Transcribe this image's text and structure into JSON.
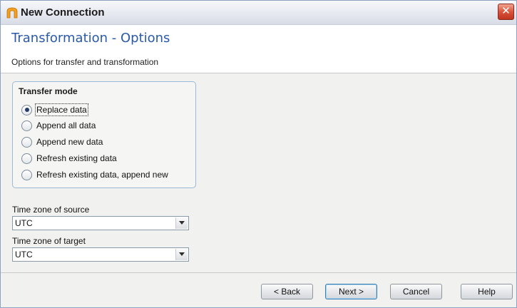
{
  "window": {
    "title": "New Connection",
    "close_glyph": "✕"
  },
  "header": {
    "title": "Transformation - Options",
    "subtitle": "Options for transfer and transformation"
  },
  "transfer_mode": {
    "label": "Transfer mode",
    "options": [
      {
        "label": "Replace data",
        "checked": true
      },
      {
        "label": "Append all data",
        "checked": false
      },
      {
        "label": "Append new data",
        "checked": false
      },
      {
        "label": "Refresh existing data",
        "checked": false
      },
      {
        "label": "Refresh existing data, append new",
        "checked": false
      }
    ]
  },
  "source_tz": {
    "label": "Time zone of source",
    "value": "UTC"
  },
  "target_tz": {
    "label": "Time zone of target",
    "value": "UTC"
  },
  "buttons": {
    "back": "< Back",
    "next": "Next >",
    "cancel": "Cancel",
    "help": "Help"
  },
  "icons": {
    "app": "app-logo-icon",
    "close": "close-icon",
    "dropdown": "chevron-down-icon"
  },
  "colors": {
    "title_accent": "#2a5aa8",
    "close_button": "#d9533a"
  }
}
